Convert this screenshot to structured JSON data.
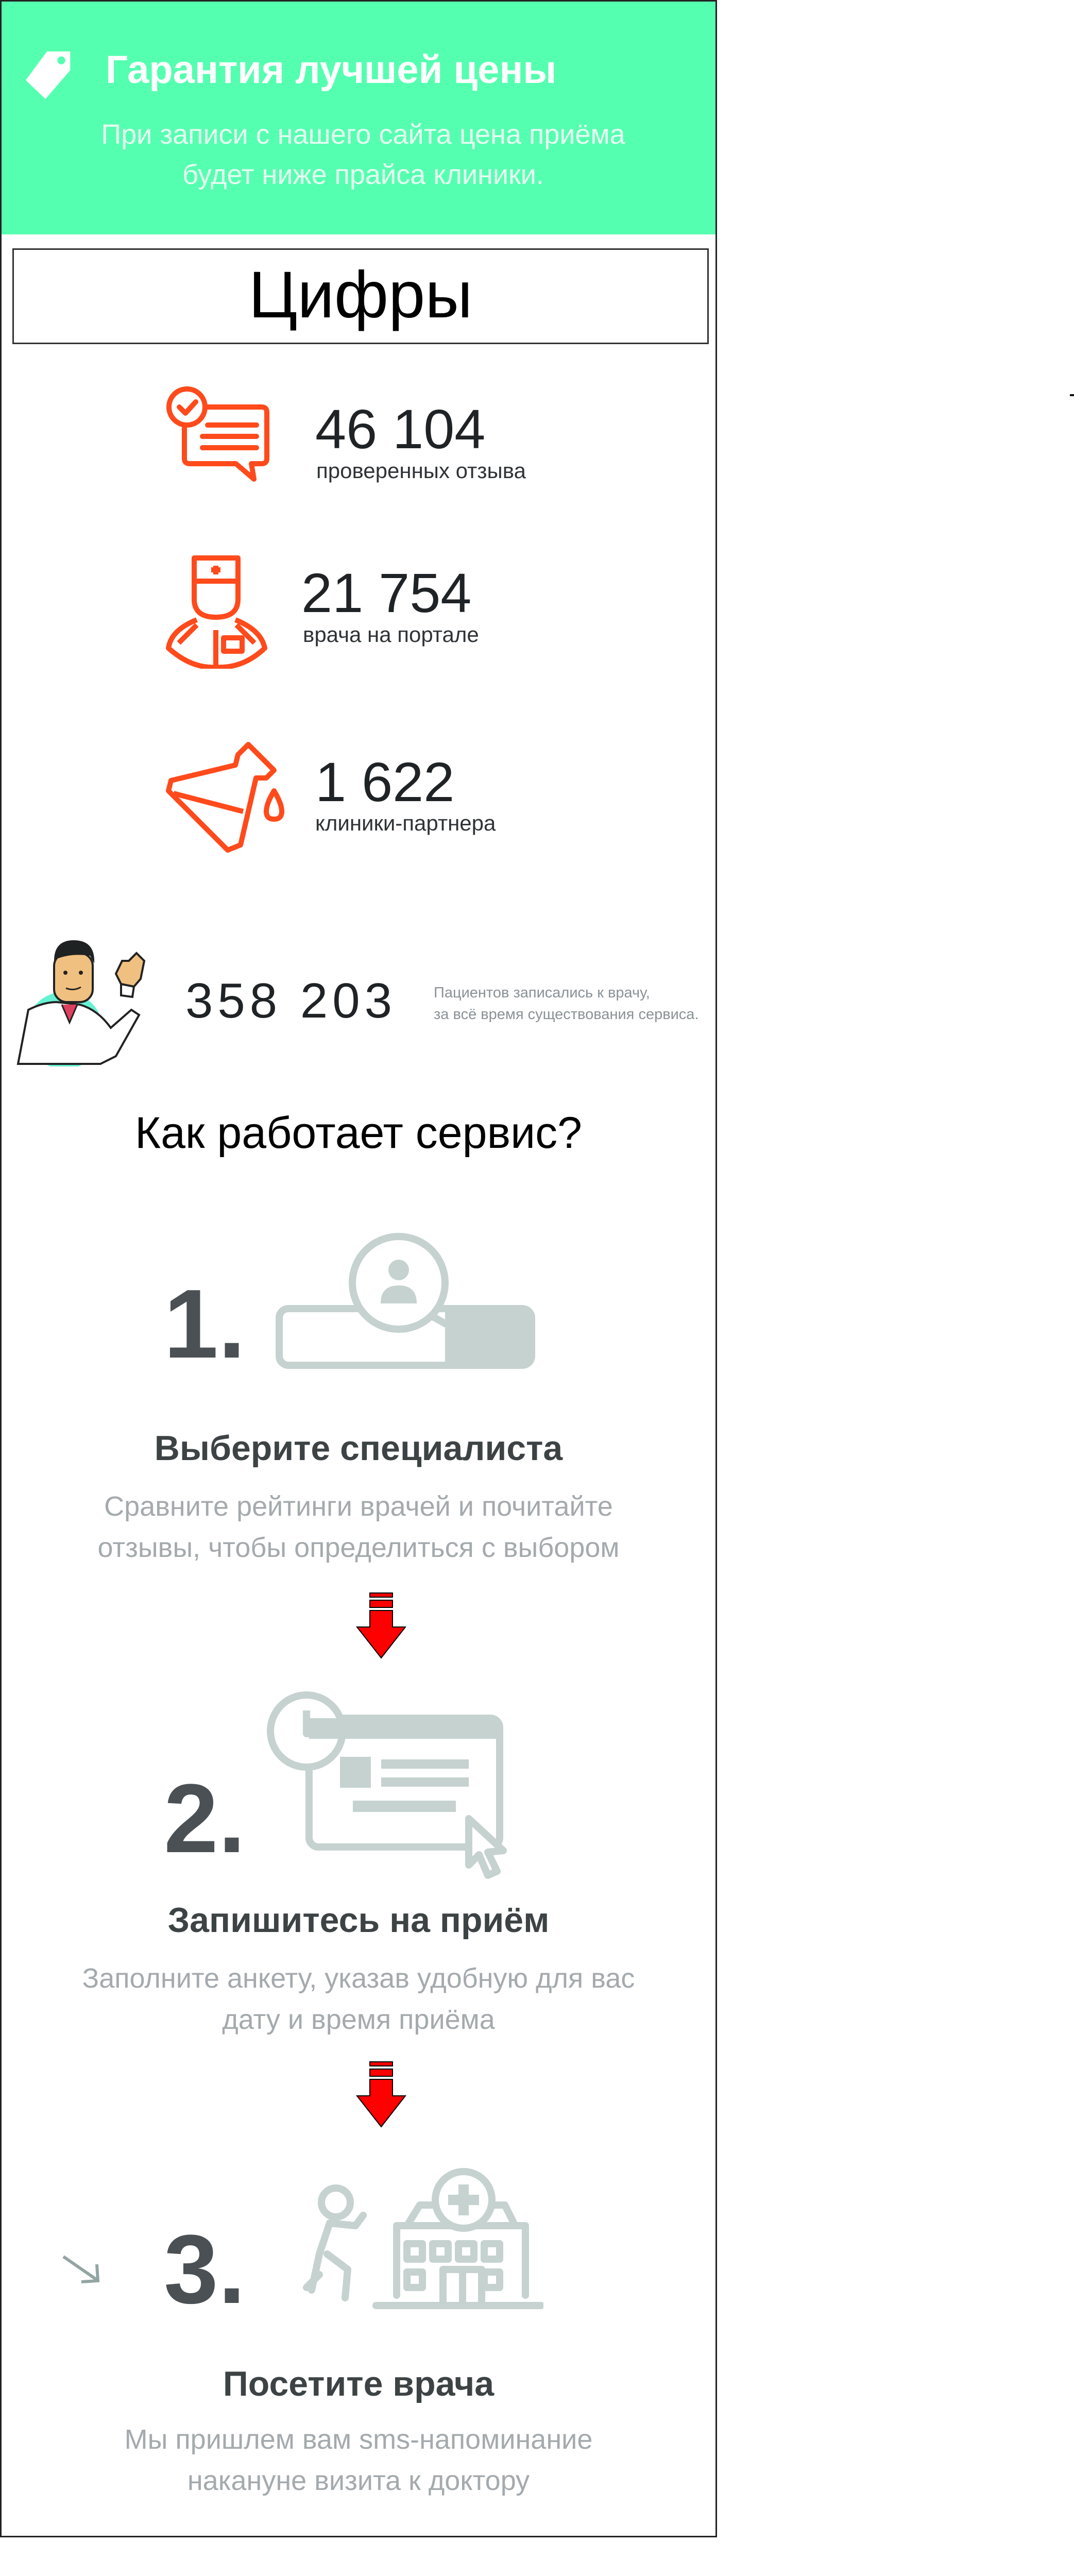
{
  "header": {
    "icon": "price-tag-icon",
    "title": "Гарантия лучшей цены",
    "subtitle_line1": "При записи с нашего сайта цена приёма",
    "subtitle_line2": "будет ниже прайса клиники."
  },
  "figures_heading": "Цифры",
  "stats": [
    {
      "icon": "verified-review-icon",
      "value": "46 104",
      "label": "проверенных отзыва"
    },
    {
      "icon": "doctor-icon",
      "value": "21 754",
      "label": "врача на портале"
    },
    {
      "icon": "flask-icon",
      "value": "1 622",
      "label": "клиники-партнера"
    }
  ],
  "patients": {
    "value": "358 203",
    "note_line1": "Пациентов записались к врачу,",
    "note_line2": "за всё время существования сервиса."
  },
  "how_heading": "Как работает сервис?",
  "steps": [
    {
      "number": "1.",
      "title": "Выберите специалиста",
      "desc_line1": "Сравните рейтинги врачей и почитайте",
      "desc_line2": "отзывы, чтобы определиться с выбором"
    },
    {
      "number": "2.",
      "title": "Запишитесь на приём",
      "desc_line1": "Заполните анкету, указав удобную для вас",
      "desc_line2": "дату и время приёма"
    },
    {
      "number": "3.",
      "title": "Посетите врача",
      "desc_line1": "Мы пришлем вам sms-напоминание",
      "desc_line2": "накануне визита к доктору"
    }
  ],
  "colors": {
    "header_bg": "#55ffb0",
    "accent": "#ff4a1c",
    "step_icon": "#c5d2d0",
    "arrow": "#ff0000"
  }
}
